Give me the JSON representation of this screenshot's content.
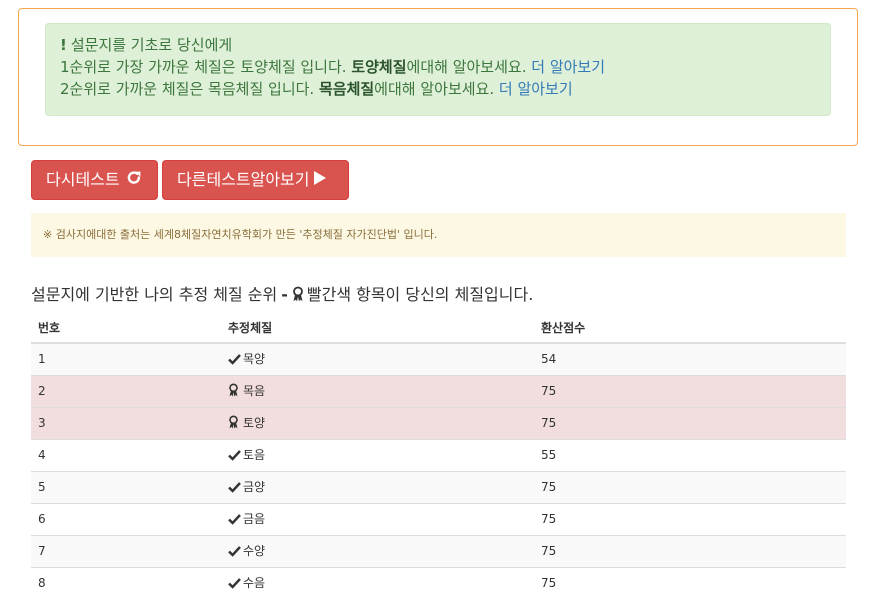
{
  "result_alert": {
    "icon": "exclamation-icon",
    "intro": "설문지를 기초로 당신에게",
    "line1": {
      "prefix": "1순위로 가장 가까운 체질은 토양체질 입니다. ",
      "bold": "토양체질",
      "suffix": "에대해 알아보세요. ",
      "link": "더 알아보기"
    },
    "line2": {
      "prefix": "2순위로 가까운 체질은 목음체질 입니다. ",
      "bold": "목음체질",
      "suffix": "에대해 알아보세요. ",
      "link": "더 알아보기"
    }
  },
  "buttons": {
    "retest": {
      "label": "다시테스트",
      "icon": "refresh-icon"
    },
    "other_tests": {
      "label": "다른테스트알아보기",
      "icon": "play-icon"
    }
  },
  "notice": "※ 검사지에대한 출처는 세계8체질자연치유학회가 만든 '추정체질 자가진단법' 입니다.",
  "ranking": {
    "heading_prefix": "설문지에 기반한 나의 추정 체질 순위",
    "heading_dash": "-",
    "heading_suffix": "빨간색 항목이 당신의 체질입니다.",
    "columns": [
      "번호",
      "추정체질",
      "환산점수"
    ],
    "rows": [
      {
        "no": "1",
        "type": "목양",
        "score": "54",
        "mark": "check-icon",
        "highlight": false
      },
      {
        "no": "2",
        "type": "목음",
        "score": "75",
        "mark": "ribbon-icon",
        "highlight": true
      },
      {
        "no": "3",
        "type": "토양",
        "score": "75",
        "mark": "ribbon-icon",
        "highlight": true
      },
      {
        "no": "4",
        "type": "토음",
        "score": "55",
        "mark": "check-icon",
        "highlight": false
      },
      {
        "no": "5",
        "type": "금양",
        "score": "75",
        "mark": "check-icon",
        "highlight": false
      },
      {
        "no": "6",
        "type": "금음",
        "score": "75",
        "mark": "check-icon",
        "highlight": false
      },
      {
        "no": "7",
        "type": "수양",
        "score": "75",
        "mark": "check-icon",
        "highlight": false
      },
      {
        "no": "8",
        "type": "수음",
        "score": "75",
        "mark": "check-icon",
        "highlight": false
      }
    ]
  },
  "colors": {
    "danger": "#d9534f",
    "success_bg": "#dff0d8",
    "success_text": "#3c763d",
    "warning_bg": "#fcf8e3",
    "highlight_row": "#f2dede",
    "link": "#337ab7"
  }
}
